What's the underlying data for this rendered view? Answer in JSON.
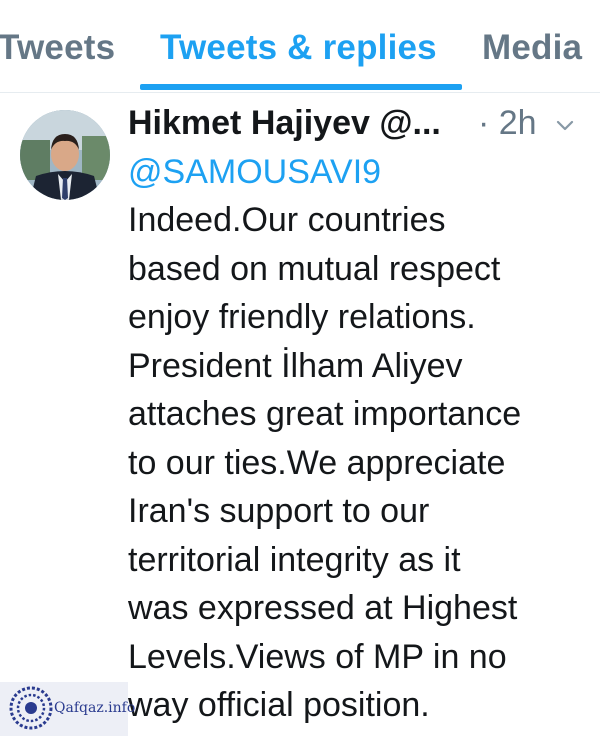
{
  "tabs": [
    {
      "label": "Tweets",
      "active": false
    },
    {
      "label": "Tweets & replies",
      "active": true
    },
    {
      "label": "Media",
      "active": false
    }
  ],
  "tweet": {
    "author_name": "Hikmet Hajiyev",
    "author_handle": "@...",
    "time": "· 2h",
    "reply_mention": "@SAMOUSAVI9",
    "text_lines": [
      "Indeed.Our countries",
      "based on mutual respect",
      "enjoy friendly relations.",
      "President İlham Aliyev",
      "attaches great importance",
      "to our ties.We appreciate",
      "Iran's support to our",
      "territorial integrity as it",
      "was expressed at Highest",
      "Levels.Views of MP in no",
      "way official position."
    ]
  },
  "watermark": {
    "text": "Qafqaz.info"
  },
  "colors": {
    "accent": "#1da1f2",
    "muted": "#657786",
    "text": "#14171a"
  }
}
